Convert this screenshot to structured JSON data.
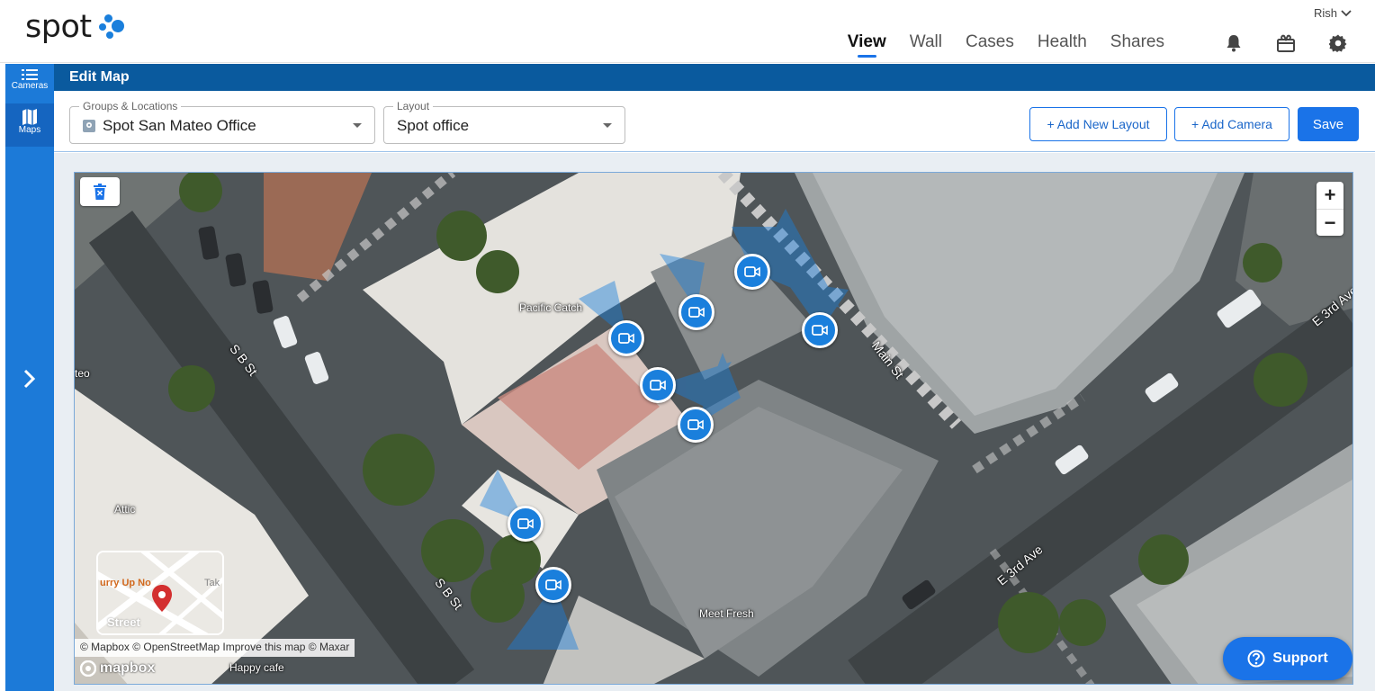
{
  "header": {
    "logo_text": "spot",
    "user_name": "Rish",
    "nav": [
      {
        "label": "View",
        "active": true
      },
      {
        "label": "Wall",
        "active": false
      },
      {
        "label": "Cases",
        "active": false
      },
      {
        "label": "Health",
        "active": false
      },
      {
        "label": "Shares",
        "active": false
      }
    ],
    "icons": [
      "bell-icon",
      "gift-icon",
      "gear-icon"
    ]
  },
  "rail": {
    "items": [
      {
        "label": "Cameras",
        "icon": "list-icon"
      },
      {
        "label": "Maps",
        "icon": "map-icon"
      }
    ],
    "expand_icon": "chevron-right-icon"
  },
  "titlebar": {
    "title": "Edit Map"
  },
  "toolbar": {
    "groups_label": "Groups & Locations",
    "groups_value": "Spot San Mateo Office",
    "layout_label": "Layout",
    "layout_value": "Spot office",
    "add_layout": "+ Add New Layout",
    "add_camera": "+ Add Camera",
    "save": "Save"
  },
  "map": {
    "zoom_in": "+",
    "zoom_out": "−",
    "labels": {
      "pacific_catch": "Pacific Catch",
      "attic": "Attic",
      "meet_fresh": "Meet Fresh",
      "happy_cafe": "Happy cafe",
      "teo": "teo"
    },
    "streets": {
      "s_b_st_1": "S B St",
      "s_b_st_2": "S B St",
      "main_st": "Main St",
      "e_3rd_ave_1": "E 3rd Ave",
      "e_3rd_ave_2": "E 3rd Ave"
    },
    "minimap": {
      "text_1": "urry Up No",
      "text_2": "Tak",
      "text_3": "Street"
    },
    "attribution": "© Mapbox © OpenStreetMap Improve this map © Maxar",
    "mapbox_logo": "mapbox",
    "cameras_count": 8
  },
  "support": {
    "label": "Support"
  },
  "colors": {
    "accent": "#1a73e8",
    "title_bar": "#0a5a9e",
    "rail": "#1c7ad8"
  }
}
